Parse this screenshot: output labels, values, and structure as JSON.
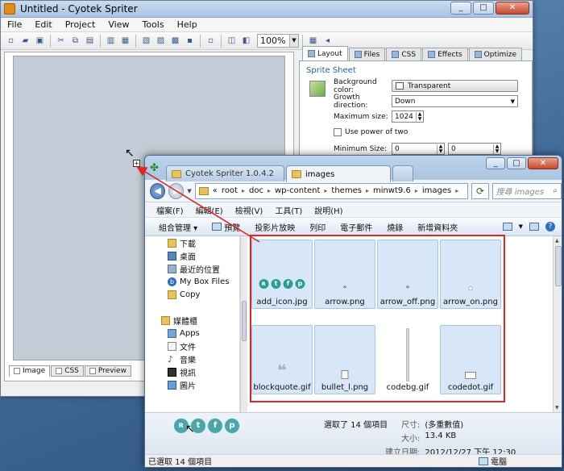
{
  "spriter": {
    "title": "Untitled - Cyotek Spriter",
    "menu": [
      "File",
      "Edit",
      "Project",
      "View",
      "Tools",
      "Help"
    ],
    "zoom": "100%",
    "canvas_tabs": [
      "Image",
      "CSS",
      "Preview"
    ],
    "prop_tabs": [
      "Layout",
      "Files",
      "CSS",
      "Effects",
      "Optimize"
    ],
    "section": "Sprite Sheet",
    "props": {
      "bg_label": "Background color:",
      "bg_value": "Transparent",
      "growth_label": "Growth direction:",
      "growth_value": "Down",
      "max_label": "Maximum size:",
      "max_value": "1024",
      "pow2_label": "Use power of two",
      "min_label": "Minimum Size:",
      "min_w": "0",
      "min_h": "0"
    }
  },
  "explorer": {
    "tabs": [
      "Cyotek Spriter 1.0.4.2",
      "images"
    ],
    "breadcrumb": [
      "«",
      "root",
      "doc",
      "wp-content",
      "themes",
      "minwt9.6",
      "images"
    ],
    "search_placeholder": "搜尋 images",
    "menu": [
      "檔案(F)",
      "編輯(E)",
      "檢視(V)",
      "工具(T)",
      "說明(H)"
    ],
    "commands": [
      "組合管理 ▾",
      "預覽",
      "投影片放映",
      "列印",
      "電子郵件",
      "燒錄",
      "新增資料夾"
    ],
    "nav": {
      "favorites": [
        "下載",
        "桌面",
        "最近的位置",
        "My Box Files",
        "Copy"
      ],
      "library_header": "媒體櫃",
      "libraries": [
        "Apps",
        "文件",
        "音樂",
        "視訊",
        "圖片"
      ]
    },
    "files": [
      {
        "name": "add_icon.jpg",
        "selected": true
      },
      {
        "name": "arrow.png",
        "selected": true
      },
      {
        "name": "arrow_off.png",
        "selected": true
      },
      {
        "name": "arrow_on.png",
        "selected": true
      },
      {
        "name": "blockquote.gif",
        "selected": true
      },
      {
        "name": "bullet_l.png",
        "selected": true
      },
      {
        "name": "codebg.gif",
        "selected": false
      },
      {
        "name": "codedot.gif",
        "selected": true
      }
    ],
    "details": {
      "count": "選取了 14 個項目",
      "size_key": "尺寸:",
      "size_val": "(多重數值)",
      "bytes_key": "大小:",
      "bytes_val": "13.4 KB",
      "date_key": "建立日期:",
      "date_val": "2012/12/27 下午 12:30"
    },
    "status_left": "已選取 14 個項目",
    "status_right": "電腦"
  },
  "colors": {
    "selection_outline": "#e12424",
    "accent": "#1f5fb0"
  }
}
